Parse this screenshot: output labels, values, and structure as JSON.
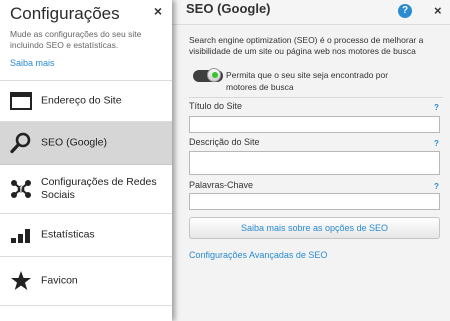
{
  "sidebar": {
    "title": "Configurações",
    "close": "×",
    "description": "Mude as configurações do seu site incluindo SEO e estatísticas.",
    "link": "Saiba mais",
    "items": [
      {
        "label": "Endereço do Site",
        "icon": "browser-window-icon"
      },
      {
        "label": "SEO (Google)",
        "icon": "magnifier-icon",
        "active": true
      },
      {
        "label": "Configurações de Redes Sociais",
        "icon": "social-network-icon"
      },
      {
        "label": "Estatísticas",
        "icon": "bar-chart-icon"
      },
      {
        "label": "Favicon",
        "icon": "star-icon"
      }
    ]
  },
  "panel": {
    "title": "SEO (Google)",
    "help": "?",
    "close": "×",
    "intro": "Search engine optimization (SEO) é o processo de melhorar a visibilidade de um site ou página web nos motores de busca",
    "toggle": {
      "label": "Permita que o seu site seja encontrado por motores de busca",
      "on": true
    },
    "fields": {
      "site_title": {
        "label": "Título do Site",
        "help": "?",
        "value": ""
      },
      "site_description": {
        "label": "Descrição do Site",
        "help": "?",
        "value": ""
      },
      "keywords": {
        "label": "Palavras-Chave",
        "help": "?",
        "value": ""
      }
    },
    "seo_button": "Saiba mais sobre as opções de SEO",
    "advanced_link": "Configurações Avançadas de SEO"
  },
  "colors": {
    "accent": "#2a8bd1",
    "toggle_on": "#37c22e",
    "active_item": "#d6d6d6"
  }
}
